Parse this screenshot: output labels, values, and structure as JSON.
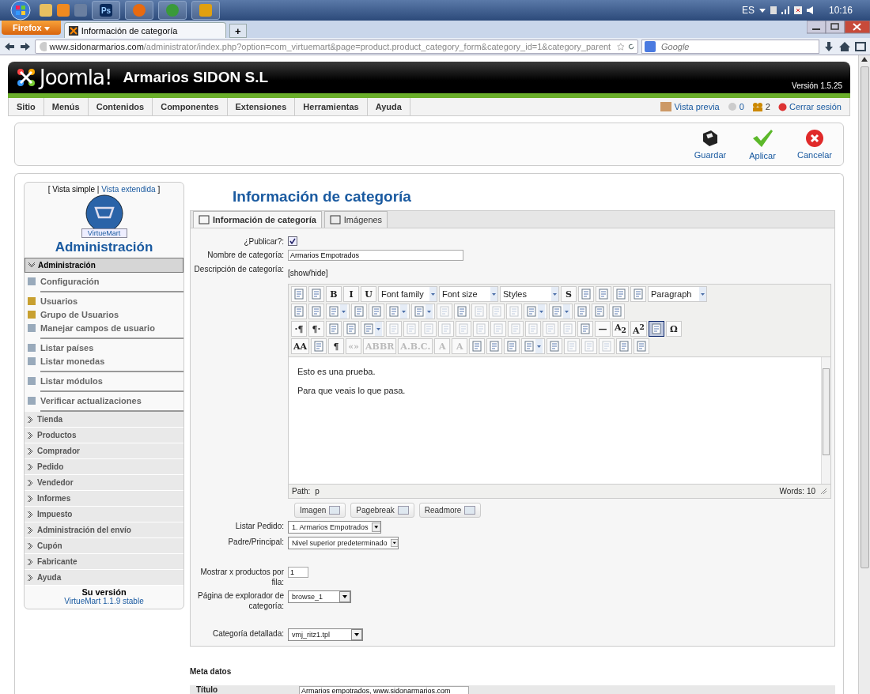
{
  "taskbar": {
    "app_label": "Ps",
    "language": "ES",
    "clock": "10:16"
  },
  "browser": {
    "menu_button": "Firefox",
    "tab_title": "Información de categoría",
    "new_tab": "+",
    "url_host": "www.sidonarmarios.com",
    "url_path": "/administrator/index.php?option=com_virtuemart&page=product.product_category_form&category_id=1&category_parent",
    "search_placeholder": "Google"
  },
  "header": {
    "logo": "Joomla!",
    "site_name": "Armarios SIDON S.L",
    "version": "Versión 1.5.25"
  },
  "menu": [
    "Sitio",
    "Menús",
    "Contenidos",
    "Componentes",
    "Extensiones",
    "Herramientas",
    "Ayuda"
  ],
  "status": {
    "preview": "Vista previa",
    "messages": "0",
    "users": "2",
    "logout": "Cerrar sesión"
  },
  "actions": [
    {
      "kind": "save",
      "label": "Guardar"
    },
    {
      "kind": "apply",
      "label": "Aplicar"
    },
    {
      "kind": "cancel",
      "label": "Cancelar"
    }
  ],
  "sidebar": {
    "view_current": "[ Vista simple |",
    "view_link": "Vista extendida",
    "view_end": "]",
    "logo_text": "VirtueMart",
    "title": "Administración",
    "sections": [
      {
        "label": "Administración",
        "expanded": true,
        "groups": [
          {
            "items": [
              "Configuración"
            ]
          },
          {
            "items": [
              "Usuarios",
              "Grupo de Usuarios",
              "Manejar campos de usuario"
            ]
          },
          {
            "items": [
              "Listar países",
              "Listar monedas"
            ]
          },
          {
            "items": [
              "Listar módulos"
            ]
          },
          {
            "items": [
              "Verificar actualizaciones"
            ]
          }
        ]
      },
      {
        "label": "Tienda",
        "expanded": false
      },
      {
        "label": "Productos",
        "expanded": false
      },
      {
        "label": "Comprador",
        "expanded": false
      },
      {
        "label": "Pedido",
        "expanded": false
      },
      {
        "label": "Vendedor",
        "expanded": false
      },
      {
        "label": "Informes",
        "expanded": false
      },
      {
        "label": "Impuesto",
        "expanded": false
      },
      {
        "label": "Administración del envío",
        "expanded": false
      },
      {
        "label": "Cupón",
        "expanded": false
      },
      {
        "label": "Fabricante",
        "expanded": false
      },
      {
        "label": "Ayuda",
        "expanded": false
      }
    ],
    "version_label": "Su versión",
    "version_value": "VirtueMart 1.1.9 stable"
  },
  "page_title": "Información de categoría",
  "tabs": [
    {
      "label": "Información de categoría",
      "selected": true
    },
    {
      "label": "Imágenes",
      "selected": false
    }
  ],
  "form": {
    "publish_label": "¿Publicar?:",
    "publish_checked": true,
    "name_label": "Nombre de categoría:",
    "name_value": "Armarios Empotrados",
    "description_label": "Descripción de categoría:",
    "show_hide": "[show/hide]"
  },
  "editor": {
    "toolbar": [
      [
        {
          "kind": "icon",
          "disabled": false,
          "active": false
        },
        {
          "kind": "icon",
          "disabled": false,
          "active": false
        },
        {
          "kind": "glyph",
          "text": "B",
          "disabled": false,
          "active": false
        },
        {
          "kind": "glyph",
          "text": "I",
          "disabled": false,
          "active": false
        },
        {
          "kind": "glyph",
          "text": "U",
          "disabled": false,
          "active": false
        },
        {
          "kind": "select",
          "text": "Font family",
          "disabled": false,
          "active": false
        },
        {
          "kind": "select",
          "text": "Font size",
          "disabled": false,
          "active": false
        },
        {
          "kind": "select",
          "text": "Styles",
          "disabled": false,
          "active": false
        },
        {
          "kind": "glyph",
          "text": "S",
          "disabled": false,
          "active": false
        },
        {
          "kind": "icon",
          "disabled": false,
          "active": false
        },
        {
          "kind": "icon",
          "disabled": false,
          "active": false
        },
        {
          "kind": "icon",
          "disabled": false,
          "active": false
        },
        {
          "kind": "icon",
          "disabled": false,
          "active": false
        },
        {
          "kind": "select",
          "text": "Paragraph",
          "disabled": false,
          "active": false
        }
      ],
      [
        {
          "kind": "icon",
          "disabled": false,
          "active": false
        },
        {
          "kind": "icon",
          "disabled": false,
          "active": false
        },
        {
          "kind": "split",
          "disabled": false,
          "active": false
        },
        {
          "kind": "icon",
          "disabled": false,
          "active": false
        },
        {
          "kind": "icon",
          "disabled": false,
          "active": false
        },
        {
          "kind": "split",
          "disabled": false,
          "active": false
        },
        {
          "kind": "split",
          "disabled": false,
          "active": false
        },
        {
          "kind": "icon",
          "disabled": true,
          "active": false
        },
        {
          "kind": "icon",
          "disabled": false,
          "active": false
        },
        {
          "kind": "icon",
          "disabled": true,
          "active": false
        },
        {
          "kind": "icon",
          "disabled": true,
          "active": false
        },
        {
          "kind": "icon",
          "disabled": true,
          "active": false
        },
        {
          "kind": "split",
          "disabled": false,
          "active": false
        },
        {
          "kind": "split",
          "disabled": false,
          "active": false
        },
        {
          "kind": "icon",
          "disabled": false,
          "active": false
        },
        {
          "kind": "icon",
          "disabled": false,
          "active": false
        },
        {
          "kind": "icon",
          "disabled": false,
          "active": false
        }
      ],
      [
        {
          "kind": "glyph",
          "text": "·¶",
          "disabled": false,
          "active": false
        },
        {
          "kind": "glyph",
          "text": "¶·",
          "disabled": false,
          "active": false
        },
        {
          "kind": "icon",
          "disabled": false,
          "active": false
        },
        {
          "kind": "icon",
          "disabled": false,
          "active": false
        },
        {
          "kind": "split",
          "disabled": false,
          "active": false
        },
        {
          "kind": "icon",
          "disabled": true,
          "active": false
        },
        {
          "kind": "icon",
          "disabled": true,
          "active": false
        },
        {
          "kind": "icon",
          "disabled": true,
          "active": false
        },
        {
          "kind": "icon",
          "disabled": true,
          "active": false
        },
        {
          "kind": "icon",
          "disabled": true,
          "active": false
        },
        {
          "kind": "icon",
          "disabled": true,
          "active": false
        },
        {
          "kind": "icon",
          "disabled": true,
          "active": false
        },
        {
          "kind": "icon",
          "disabled": true,
          "active": false
        },
        {
          "kind": "icon",
          "disabled": true,
          "active": false
        },
        {
          "kind": "icon",
          "disabled": true,
          "active": false
        },
        {
          "kind": "icon",
          "disabled": true,
          "active": false
        },
        {
          "kind": "icon",
          "disabled": false,
          "active": false
        },
        {
          "kind": "glyph",
          "text": "—",
          "disabled": false,
          "active": false
        },
        {
          "kind": "glyph",
          "text": "A$_{2}$",
          "disabled": false,
          "active": false
        },
        {
          "kind": "glyph",
          "text": "A$^{2}$",
          "disabled": false,
          "active": false
        },
        {
          "kind": "icon",
          "disabled": false,
          "active": true
        },
        {
          "kind": "glyph",
          "text": "Ω",
          "disabled": false,
          "active": false
        }
      ],
      [
        {
          "kind": "glyph",
          "text": "AA",
          "disabled": false,
          "active": false
        },
        {
          "kind": "icon",
          "disabled": false,
          "active": false
        },
        {
          "kind": "glyph",
          "text": "¶",
          "disabled": false,
          "active": false
        },
        {
          "kind": "glyph",
          "text": "«»",
          "disabled": true,
          "active": false
        },
        {
          "kind": "glyph",
          "text": "ABBR",
          "disabled": true,
          "active": false
        },
        {
          "kind": "glyph",
          "text": "A.B.C.",
          "disabled": true,
          "active": false
        },
        {
          "kind": "glyph",
          "text": "A",
          "disabled": true,
          "active": false
        },
        {
          "kind": "glyph",
          "text": "A",
          "disabled": true,
          "active": false
        },
        {
          "kind": "icon",
          "disabled": false,
          "active": false
        },
        {
          "kind": "icon",
          "disabled": false,
          "active": false
        },
        {
          "kind": "icon",
          "disabled": false,
          "active": false
        },
        {
          "kind": "split",
          "disabled": false,
          "active": false
        },
        {
          "kind": "icon",
          "disabled": false,
          "active": false
        },
        {
          "kind": "icon",
          "disabled": true,
          "active": false
        },
        {
          "kind": "icon",
          "disabled": true,
          "active": false
        },
        {
          "kind": "icon",
          "disabled": true,
          "active": false
        },
        {
          "kind": "icon",
          "disabled": false,
          "active": false
        },
        {
          "kind": "icon",
          "disabled": false,
          "active": false
        }
      ]
    ],
    "paragraphs": [
      "Esto es una prueba.",
      "Para que veais lo que pasa."
    ],
    "path_label": "Path:",
    "path_value": "p",
    "words": "Words: 10",
    "buttons": [
      "Imagen",
      "Pagebreak",
      "Readmore"
    ]
  },
  "fields": [
    {
      "kind": "select",
      "label": "Listar Pedido:",
      "value": "1. Armarios Empotrados"
    },
    {
      "kind": "select",
      "label": "Padre/Principal:",
      "value": "Nivel superior predeterminado"
    },
    {
      "kind": "text",
      "label": "Mostrar x productos por fila:",
      "value": "1"
    },
    {
      "kind": "select",
      "label": "Página de explorador de categoría:",
      "value": "browse_1"
    },
    {
      "kind": "select",
      "label": "Categoría detallada:",
      "value": "vmj_ritz1.tpl"
    }
  ],
  "meta": {
    "heading": "Meta datos",
    "title_label": "Título",
    "title_value": "Armarios empotrados, www.sidonarmarios.com"
  }
}
